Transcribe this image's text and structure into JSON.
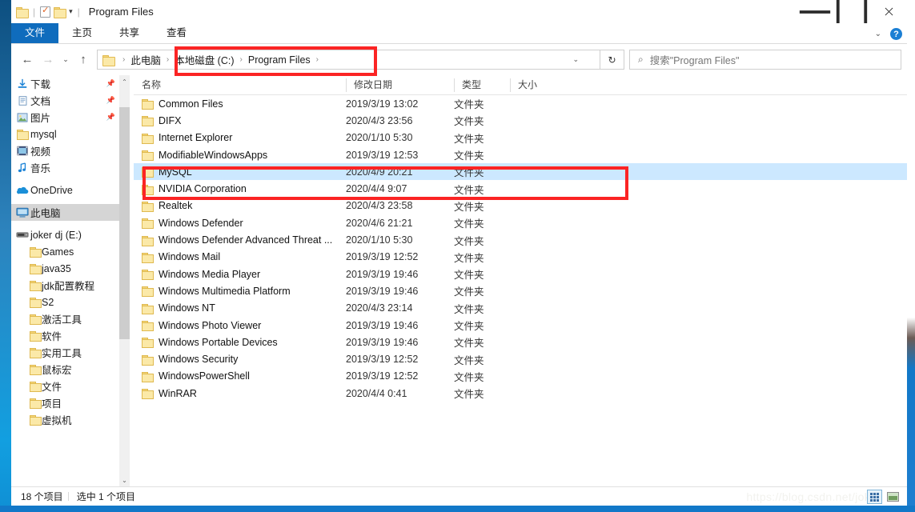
{
  "window": {
    "title": "Program Files",
    "quick_access": [
      "folder-icon",
      "properties-icon",
      "new-folder-icon",
      "customize-caret-icon"
    ],
    "controls": {
      "minimize": "minimize-icon",
      "maximize": "maximize-icon",
      "close": "close-icon"
    }
  },
  "ribbon": {
    "tabs": [
      {
        "label": "文件",
        "active": true
      },
      {
        "label": "主页",
        "active": false
      },
      {
        "label": "共享",
        "active": false
      },
      {
        "label": "查看",
        "active": false
      }
    ],
    "collapse": "chevron-down-icon",
    "help": "?"
  },
  "address": {
    "back": "←",
    "forward": "→",
    "recent": "⌄",
    "up": "↑",
    "breadcrumb": [
      "此电脑",
      "本地磁盘 (C:)",
      "Program Files"
    ],
    "separator": "›",
    "dropdown": "⌄",
    "refresh": "↻"
  },
  "search": {
    "placeholder": "搜索\"Program Files\"",
    "icon": "search-icon"
  },
  "sidebar": {
    "items": [
      {
        "label": "下载",
        "icon": "download-icon",
        "pinned": true,
        "indent": false
      },
      {
        "label": "文档",
        "icon": "documents-icon",
        "pinned": true,
        "indent": false
      },
      {
        "label": "图片",
        "icon": "pictures-icon",
        "pinned": true,
        "indent": false
      },
      {
        "label": "mysql",
        "icon": "folder-icon",
        "pinned": false,
        "indent": false
      },
      {
        "label": "视频",
        "icon": "videos-icon",
        "pinned": false,
        "indent": false
      },
      {
        "label": "音乐",
        "icon": "music-icon",
        "pinned": false,
        "indent": false
      },
      {
        "label": "OneDrive",
        "icon": "onedrive-icon",
        "pinned": false,
        "indent": false,
        "gap": true
      },
      {
        "label": "此电脑",
        "icon": "this-pc-icon",
        "pinned": false,
        "indent": false,
        "selected": true,
        "gap": true
      },
      {
        "label": "joker dj (E:)",
        "icon": "drive-icon",
        "pinned": false,
        "indent": false,
        "gap": true
      },
      {
        "label": "Games",
        "icon": "folder-icon",
        "pinned": false,
        "indent": true
      },
      {
        "label": "java35",
        "icon": "folder-icon",
        "pinned": false,
        "indent": true
      },
      {
        "label": "jdk配置教程",
        "icon": "folder-icon",
        "pinned": false,
        "indent": true
      },
      {
        "label": "S2",
        "icon": "folder-icon",
        "pinned": false,
        "indent": true
      },
      {
        "label": "激活工具",
        "icon": "folder-icon",
        "pinned": false,
        "indent": true
      },
      {
        "label": "软件",
        "icon": "folder-icon",
        "pinned": false,
        "indent": true
      },
      {
        "label": "实用工具",
        "icon": "folder-icon",
        "pinned": false,
        "indent": true
      },
      {
        "label": "鼠标宏",
        "icon": "folder-icon",
        "pinned": false,
        "indent": true
      },
      {
        "label": "文件",
        "icon": "folder-icon",
        "pinned": false,
        "indent": true
      },
      {
        "label": "项目",
        "icon": "folder-icon",
        "pinned": false,
        "indent": true
      },
      {
        "label": "虚拟机",
        "icon": "folder-icon",
        "pinned": false,
        "indent": true
      }
    ],
    "scroll_up": "⌃",
    "scroll_down": "⌄"
  },
  "filelist": {
    "columns": [
      {
        "label": "名称",
        "key": "name"
      },
      {
        "label": "修改日期",
        "key": "date"
      },
      {
        "label": "类型",
        "key": "type"
      },
      {
        "label": "大小",
        "key": "size"
      }
    ],
    "rows": [
      {
        "name": "Common Files",
        "date": "2019/3/19 13:02",
        "type": "文件夹",
        "size": ""
      },
      {
        "name": "DIFX",
        "date": "2020/4/3 23:56",
        "type": "文件夹",
        "size": ""
      },
      {
        "name": "Internet Explorer",
        "date": "2020/1/10 5:30",
        "type": "文件夹",
        "size": ""
      },
      {
        "name": "ModifiableWindowsApps",
        "date": "2019/3/19 12:53",
        "type": "文件夹",
        "size": ""
      },
      {
        "name": "MySQL",
        "date": "2020/4/9 20:21",
        "type": "文件夹",
        "size": "",
        "selected": true
      },
      {
        "name": "NVIDIA Corporation",
        "date": "2020/4/4 9:07",
        "type": "文件夹",
        "size": ""
      },
      {
        "name": "Realtek",
        "date": "2020/4/3 23:58",
        "type": "文件夹",
        "size": ""
      },
      {
        "name": "Windows Defender",
        "date": "2020/4/6 21:21",
        "type": "文件夹",
        "size": ""
      },
      {
        "name": "Windows Defender Advanced Threat ...",
        "date": "2020/1/10 5:30",
        "type": "文件夹",
        "size": ""
      },
      {
        "name": "Windows Mail",
        "date": "2019/3/19 12:52",
        "type": "文件夹",
        "size": ""
      },
      {
        "name": "Windows Media Player",
        "date": "2019/3/19 19:46",
        "type": "文件夹",
        "size": ""
      },
      {
        "name": "Windows Multimedia Platform",
        "date": "2019/3/19 19:46",
        "type": "文件夹",
        "size": ""
      },
      {
        "name": "Windows NT",
        "date": "2020/4/3 23:14",
        "type": "文件夹",
        "size": ""
      },
      {
        "name": "Windows Photo Viewer",
        "date": "2019/3/19 19:46",
        "type": "文件夹",
        "size": ""
      },
      {
        "name": "Windows Portable Devices",
        "date": "2019/3/19 19:46",
        "type": "文件夹",
        "size": ""
      },
      {
        "name": "Windows Security",
        "date": "2019/3/19 12:52",
        "type": "文件夹",
        "size": ""
      },
      {
        "name": "WindowsPowerShell",
        "date": "2019/3/19 12:52",
        "type": "文件夹",
        "size": ""
      },
      {
        "name": "WinRAR",
        "date": "2020/4/4 0:41",
        "type": "文件夹",
        "size": ""
      }
    ]
  },
  "status": {
    "item_count": "18 个项目",
    "selection": "选中 1 个项目",
    "views": [
      "details-view-icon",
      "thumbnail-view-icon"
    ]
  },
  "watermark": "https://blog.csdn.net/jok",
  "colors": {
    "accent": "#0f6cbd",
    "selection": "#cce8ff",
    "annotation": "#fb2424"
  }
}
